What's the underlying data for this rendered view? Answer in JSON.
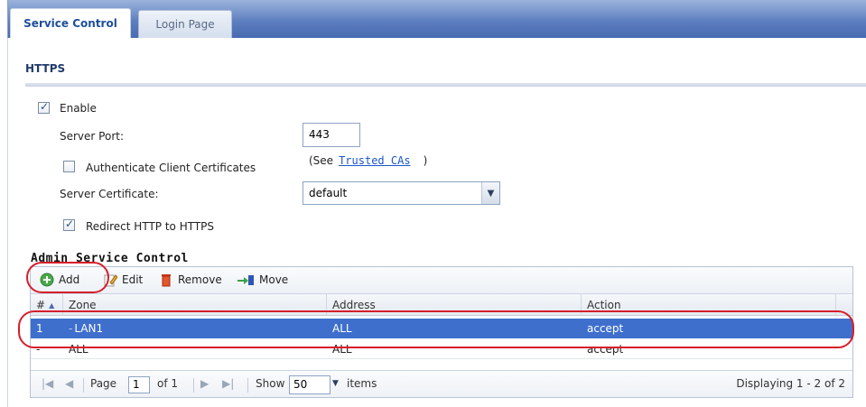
{
  "tabs": [
    {
      "label": "Service Control",
      "active": true
    },
    {
      "label": "Login Page",
      "active": false
    }
  ],
  "https": {
    "section_title": "HTTPS",
    "enable_label": "Enable",
    "enable_checked": true,
    "server_port_label": "Server Port:",
    "server_port_value": "443",
    "auth_client_label": "Authenticate Client Certificates",
    "auth_client_checked": false,
    "see_prefix": "(See",
    "trusted_cas_link": "Trusted CAs",
    "see_suffix": ")",
    "server_cert_label": "Server Certificate:",
    "server_cert_value": "default",
    "redirect_label": "Redirect HTTP to HTTPS",
    "redirect_checked": true
  },
  "admin": {
    "title": "Admin Service Control",
    "toolbar": {
      "add": "Add",
      "edit": "Edit",
      "remove": "Remove",
      "move": "Move"
    },
    "columns": [
      "#",
      "Zone",
      "Address",
      "Action"
    ],
    "rows": [
      {
        "num": "1",
        "zone": "LAN1",
        "address": "ALL",
        "action": "accept",
        "selected": true
      },
      {
        "num": "-",
        "zone": "ALL",
        "address": "ALL",
        "action": "accept",
        "selected": false
      }
    ],
    "pager": {
      "page_label": "Page",
      "page_value": "1",
      "of_label": "of 1",
      "show_label": "Show",
      "show_value": "50",
      "items_label": "items",
      "displaying": "Displaying 1 - 2 of 2"
    }
  },
  "colors": {
    "tab_bar": "#5e7fc0",
    "selected_row": "#3f6fcc",
    "highlight_ring": "#d61e2a",
    "link": "#1a56c9"
  }
}
